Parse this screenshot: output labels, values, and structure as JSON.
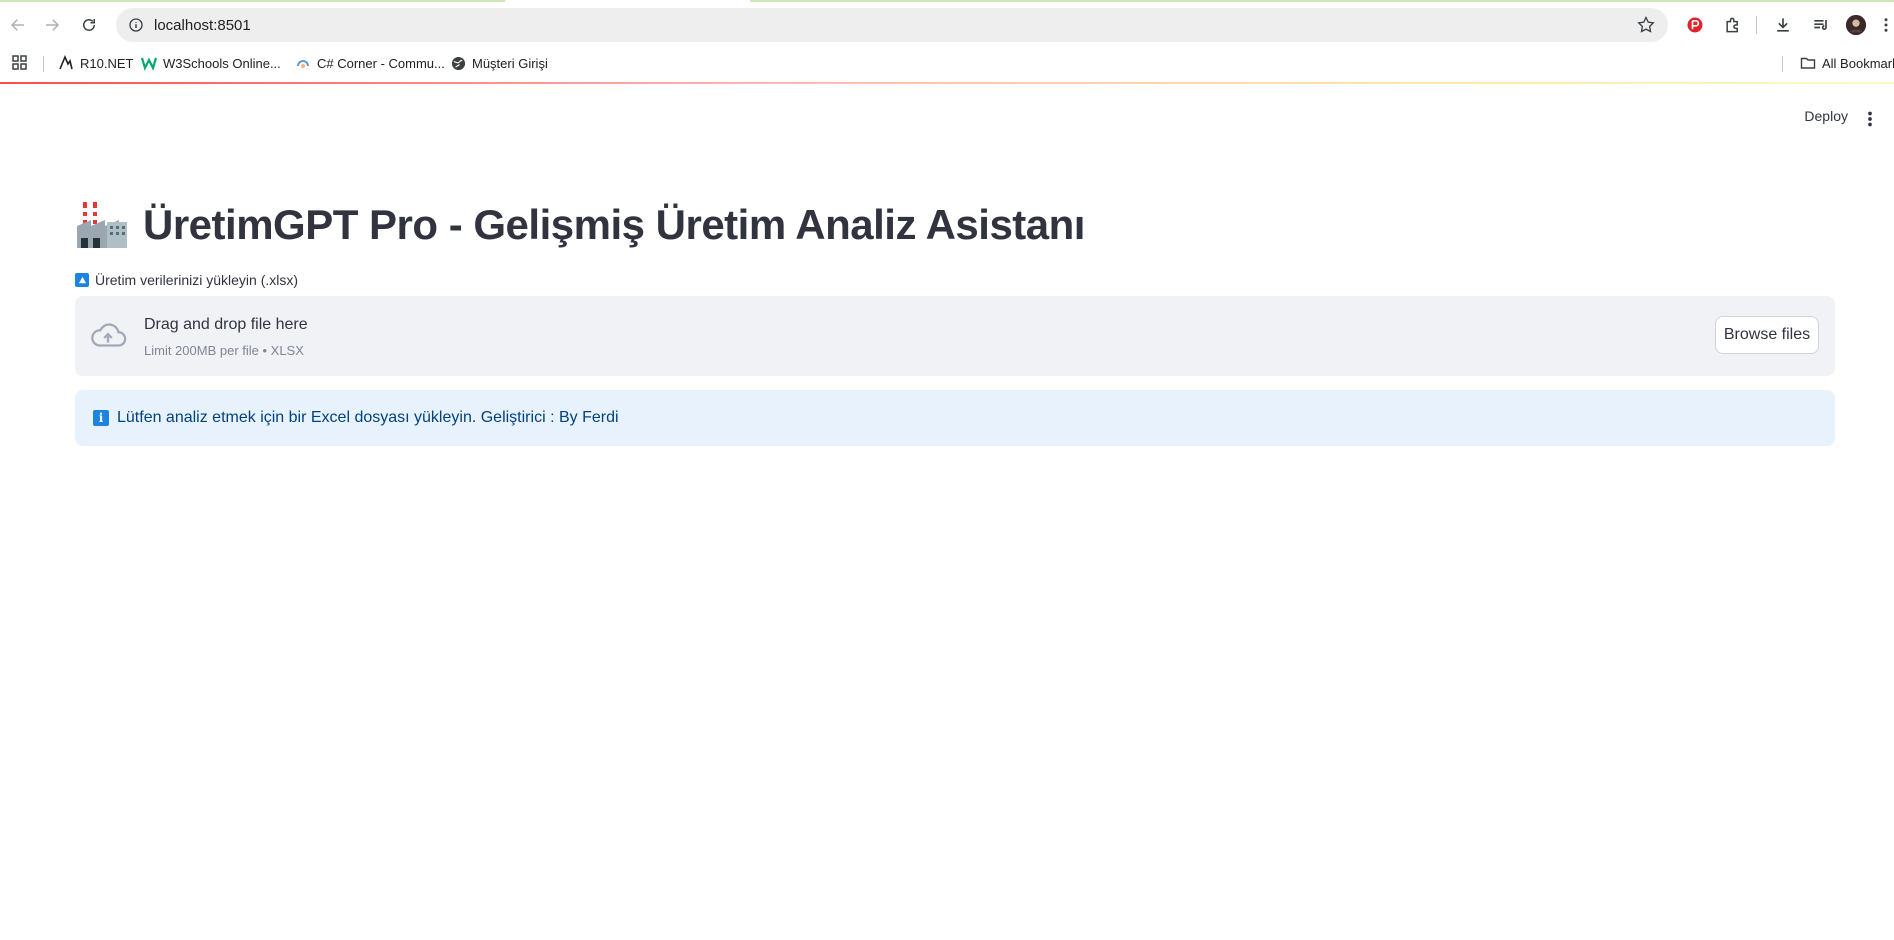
{
  "browser": {
    "url": "localhost:8501",
    "bookmarks": [
      {
        "label": "R10.NET",
        "icon": "r10-icon"
      },
      {
        "label": "W3Schools Online...",
        "icon": "w3schools-icon"
      },
      {
        "label": "C# Corner - Commu...",
        "icon": "csharp-corner-icon"
      },
      {
        "label": "Müşteri Girişi",
        "icon": "globe-icon"
      }
    ],
    "all_bookmarks_label": "All Bookmarks"
  },
  "app": {
    "deploy_label": "Deploy",
    "title": "ÜretimGPT Pro - Gelişmiş Üretim Analiz Asistanı",
    "title_icon": "factory-emoji",
    "uploader": {
      "label": "Üretim verilerinizi yükleyin (.xlsx)",
      "drop_text": "Drag and drop file here",
      "limit_text": "Limit 200MB per file • XLSX",
      "browse_label": "Browse files"
    },
    "info_message": "Lütfen analiz etmek için bir Excel dosyası yükleyin. Geliştirici : By Ferdi"
  },
  "colors": {
    "accent": "#ff4b4b",
    "info_bg": "#e8f2fc",
    "info_text": "#004280",
    "info_icon": "#1c83e1"
  }
}
